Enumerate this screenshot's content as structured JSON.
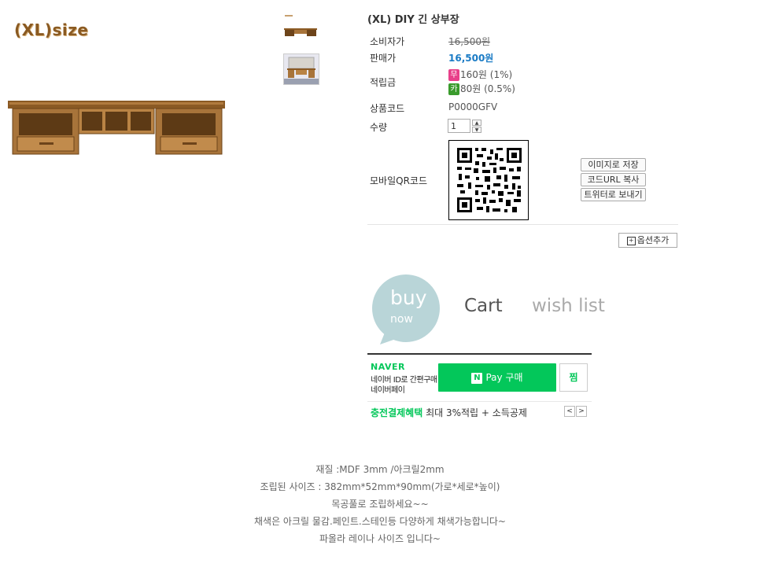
{
  "product": {
    "size_label": "(XL)size",
    "title": "(XL) DIY 긴 상부장",
    "consumer_price_label": "소비자가",
    "consumer_price": "16,500원",
    "sale_price_label": "판매가",
    "sale_price": "16,500원",
    "points_label": "적립금",
    "points_no_badge": "무",
    "points_no": "160원 (1%)",
    "points_card_badge": "카",
    "points_card": "80원 (0.5%)",
    "code_label": "상품코드",
    "code": "P0000GFV",
    "qty_label": "수량",
    "qty_value": "1",
    "qr_label": "모바일QR코드"
  },
  "qr_buttons": {
    "save_image": "이미지로 저장",
    "copy_url": "코드URL 복사",
    "twitter": "트위터로 보내기"
  },
  "option_add": "옵션추가",
  "actions": {
    "buy": "buy",
    "now": "now",
    "cart": "Cart",
    "wish": "wish list"
  },
  "naver": {
    "logo": "NAVER",
    "sub1": "네이버 ID로 간편구매",
    "sub2": "네이버페이",
    "pay_n": "N",
    "pay_label": "Pay 구매",
    "zzim": "찜",
    "charge_highlight": "충전결제혜택",
    "charge_rest": "최대 3%적립 + 소득공제"
  },
  "description": [
    "재질 :MDF 3mm /아크릴2mm",
    "조립된 사이즈  : 382mm*52mm*90mm(가로*세로*높이)",
    "목공풀로 조립하세요~~",
    "채색은 아크릴 물감.페인트.스테인등 다양하게 채색가능합니다~",
    "파올라 레이나 사이즈 입니다~"
  ],
  "colors": {
    "accent_blue": "#1a7bc5",
    "naver_green": "#03c75a",
    "buy_circle": "#b9d5d8"
  }
}
